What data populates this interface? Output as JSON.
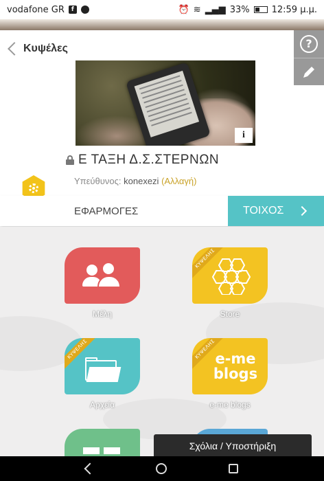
{
  "status_bar": {
    "carrier": "vodafone GR",
    "battery": "33%",
    "time": "12:59 μ.μ."
  },
  "header": {
    "back_label": "Κυψέλες",
    "help_icon": "question-circle-icon",
    "edit_icon": "pencil-icon"
  },
  "class": {
    "title": "Ε ΤΑΞΗ Δ.Σ.ΣΤΕΡΝΩΝ",
    "owner_prefix": "Υπεύθυνος:",
    "owner_name": "konexezi",
    "change_link": "(Αλλαγή)",
    "info_label": "i"
  },
  "tabs": {
    "apps_label": "ΕΦΑΡΜΟΓΕΣ",
    "wall_label": "ΤΟΙΧΟΣ"
  },
  "apps": [
    {
      "label": "Μέλη",
      "color": "#e25b5b",
      "icon": "users-icon"
    },
    {
      "label": "Store",
      "color": "#f3c322",
      "icon": "hexagons-icon",
      "ribbon": "ΚΥΨΕΛΗΣ"
    },
    {
      "label": "Αρχεία",
      "color": "#55c3c6",
      "icon": "folder-icon",
      "ribbon": "ΚΥΨΕΛΗΣ"
    },
    {
      "label": "e-me blogs",
      "color": "#f3c322",
      "icon": "blog-icon",
      "ribbon": "ΚΥΨΕΛΗΣ",
      "tile_text": "e-me blogs"
    }
  ],
  "support_label": "Σχόλια / Υποστήριξη",
  "colors": {
    "accent_teal": "#55c3c6",
    "accent_yellow": "#f2c31a",
    "members_red": "#e25b5b"
  }
}
